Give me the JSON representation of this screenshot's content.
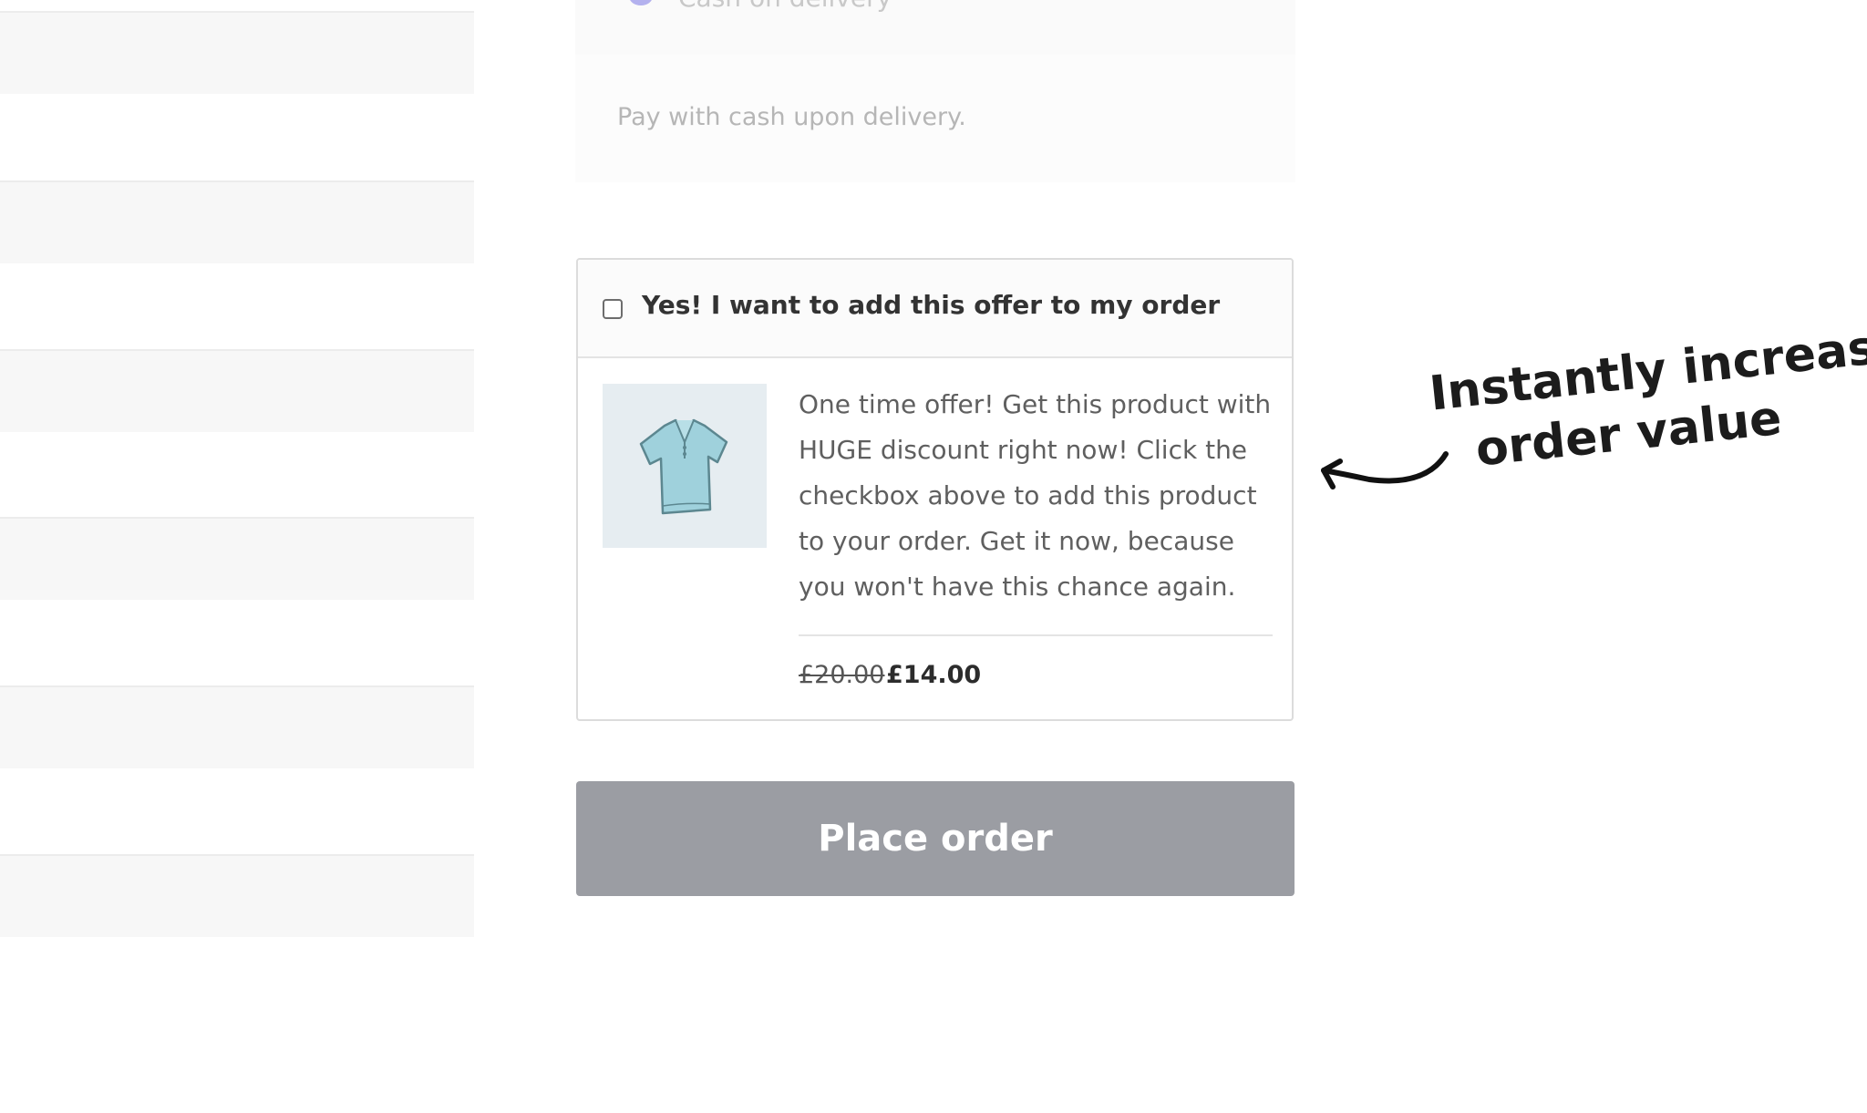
{
  "payment": {
    "method_label": "Cash on delivery",
    "description": "Pay with cash upon delivery.",
    "radio_color": "#b3b1ee"
  },
  "offer": {
    "checkbox_label": "Yes! I want to add this offer to my order",
    "checked": false,
    "image_icon": "polo-shirt-icon",
    "description": "One time offer! Get this product with HUGE discount right now! Click the checkbox above to add this product to your order. Get it now, because you won't have this chance again.",
    "price_old": "£20.00",
    "price_new": "£14.00"
  },
  "actions": {
    "place_order_label": "Place order",
    "button_color": "#9b9da3"
  },
  "annotation": {
    "line1": "Instantly increase",
    "line2": "order value",
    "icon": "curved-arrow-icon"
  }
}
